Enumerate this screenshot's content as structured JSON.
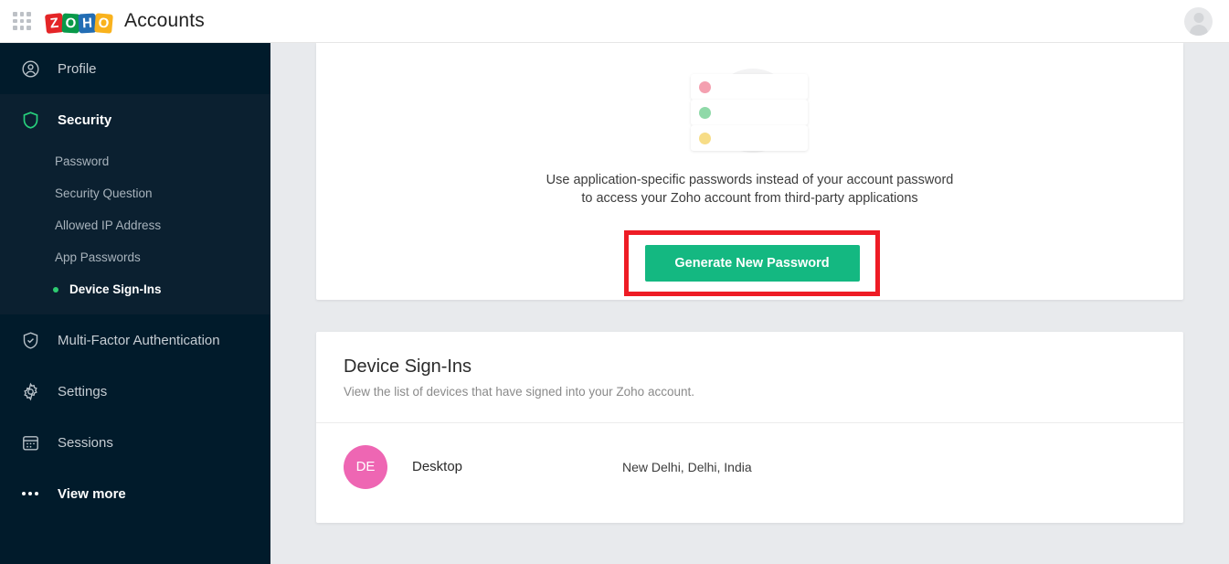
{
  "topbar": {
    "apps_icon": "apps-grid-icon",
    "logo": {
      "tiles": [
        "Z",
        "O",
        "H",
        "O"
      ],
      "colors": [
        "#e42527",
        "#089949",
        "#226db4",
        "#f9b21d"
      ]
    },
    "title": "Accounts",
    "avatar_icon": "user-avatar-icon"
  },
  "sidebar": {
    "items": [
      {
        "label": "Profile",
        "icon": "user-circle-icon",
        "active": false
      },
      {
        "label": "Security",
        "icon": "shield-icon",
        "active": true
      },
      {
        "label": "Multi-Factor Authentication",
        "icon": "shield-check-icon",
        "active": false
      },
      {
        "label": "Settings",
        "icon": "gear-icon",
        "active": false
      },
      {
        "label": "Sessions",
        "icon": "calendar-icon",
        "active": false
      },
      {
        "label": "View more",
        "icon": "ellipsis-icon",
        "active": false
      }
    ],
    "security_subitems": [
      {
        "label": "Password",
        "selected": false
      },
      {
        "label": "Security Question",
        "selected": false
      },
      {
        "label": "Allowed IP Address",
        "selected": false
      },
      {
        "label": "App Passwords",
        "selected": false
      },
      {
        "label": "Device Sign-Ins",
        "selected": true
      }
    ],
    "accent_color": "#2ecc71"
  },
  "main": {
    "app_passwords_card": {
      "description": "Use application-specific passwords instead of your account password to access your Zoho account from third-party applications",
      "generate_button": "Generate New Password",
      "button_color": "#14b881",
      "annotation_color": "#ee1c25",
      "illustration": {
        "icon": "stacked-cards-illustration",
        "dot_colors": [
          "#f4a0b0",
          "#8fd9a8",
          "#f7dd87"
        ]
      }
    },
    "device_signins_card": {
      "title": "Device Sign-Ins",
      "subtitle": "View the list of devices that have signed into your Zoho account.",
      "rows": [
        {
          "initials": "DE",
          "avatar_color": "#ee66b3",
          "device": "Desktop",
          "location": "New Delhi, Delhi, India"
        }
      ]
    }
  }
}
